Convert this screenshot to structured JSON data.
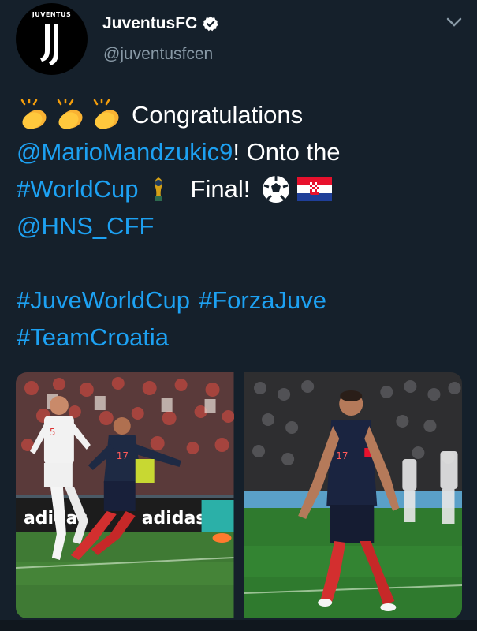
{
  "account": {
    "avatar_brand": "JUVENTUS",
    "display_name": "JuventusFC",
    "handle": "@juventusfcen",
    "verified_icon": "verified-badge-icon",
    "menu_icon": "chevron-down-icon"
  },
  "tweet": {
    "line1_text": "Congratulations",
    "mention1": "@MarioMandzukic9",
    "line2_text": "! Onto the",
    "hashtag1": "#WorldCup",
    "line3_text": "Final!",
    "mention2": "@HNS_CFF",
    "hashtag2": "#JuveWorldCup",
    "hashtag3": "#ForzaJuve",
    "hashtag4": "#TeamCroatia",
    "emojis": [
      "clapping-hands-icon",
      "clapping-hands-icon",
      "clapping-hands-icon",
      "world-cup-trophy-icon",
      "soccer-ball-icon",
      "croatia-flag-icon"
    ]
  },
  "media": {
    "photos": [
      "match-photo-left",
      "match-photo-right"
    ],
    "left_ad_text": "adidas",
    "left_shirt_white": "5",
    "left_shirt_dark": "17",
    "right_shirt": "17"
  },
  "colors": {
    "background": "#15202b",
    "link": "#1da1f2",
    "secondary_text": "#8899a6"
  }
}
